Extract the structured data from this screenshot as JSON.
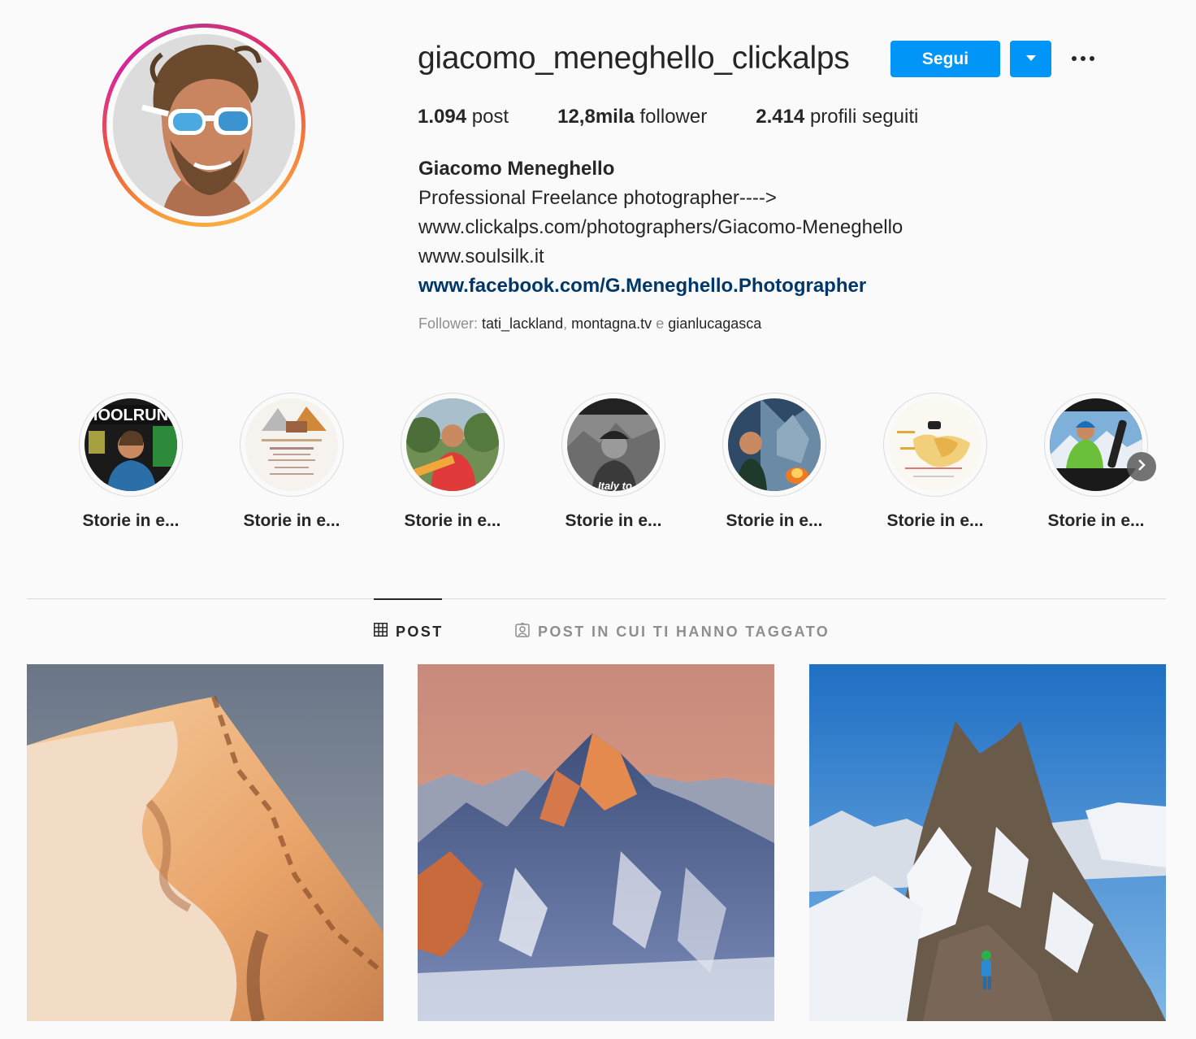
{
  "profile": {
    "username": "giacomo_meneghello_clickalps",
    "follow_label": "Segui",
    "stats": {
      "posts_count": "1.094",
      "posts_label": "post",
      "followers_count": "12,8mila",
      "followers_label": "follower",
      "following_count": "2.414",
      "following_label": "profili seguiti"
    },
    "full_name": "Giacomo Meneghello",
    "bio_lines": [
      "Professional Freelance photographer---->",
      "www.clickalps.com/photographers/Giacomo-Meneghello",
      "www.soulsilk.it"
    ],
    "website": "www.facebook.com/G.Meneghello.Photographer",
    "followed_by": {
      "prefix": "Follower: ",
      "users": [
        "tati_lackland",
        "montagna.tv",
        "gianlucagasca"
      ],
      "separator": ", ",
      "conjunction": " e "
    }
  },
  "highlights": [
    {
      "label": "Storie in e..."
    },
    {
      "label": "Storie in e..."
    },
    {
      "label": "Storie in e..."
    },
    {
      "label": "Storie in e..."
    },
    {
      "label": "Storie in e..."
    },
    {
      "label": "Storie in e..."
    },
    {
      "label": "Storie in e..."
    }
  ],
  "highlight_image_text": {
    "h1_banner": "HOOLRUN",
    "h4_caption": "Italy to"
  },
  "tabs": {
    "posts": "POST",
    "tagged": "POST IN CUI TI HANNO TAGGATO"
  },
  "icons": {
    "dropdown": "chevron-down-icon",
    "more": "more-options-icon",
    "grid": "grid-icon",
    "tagged": "tagged-user-icon",
    "next": "chevron-right-icon"
  },
  "colors": {
    "accent": "#0095f6",
    "link": "#00376b",
    "text": "#262626",
    "muted": "#8e8e8e",
    "background": "#fafafa"
  }
}
